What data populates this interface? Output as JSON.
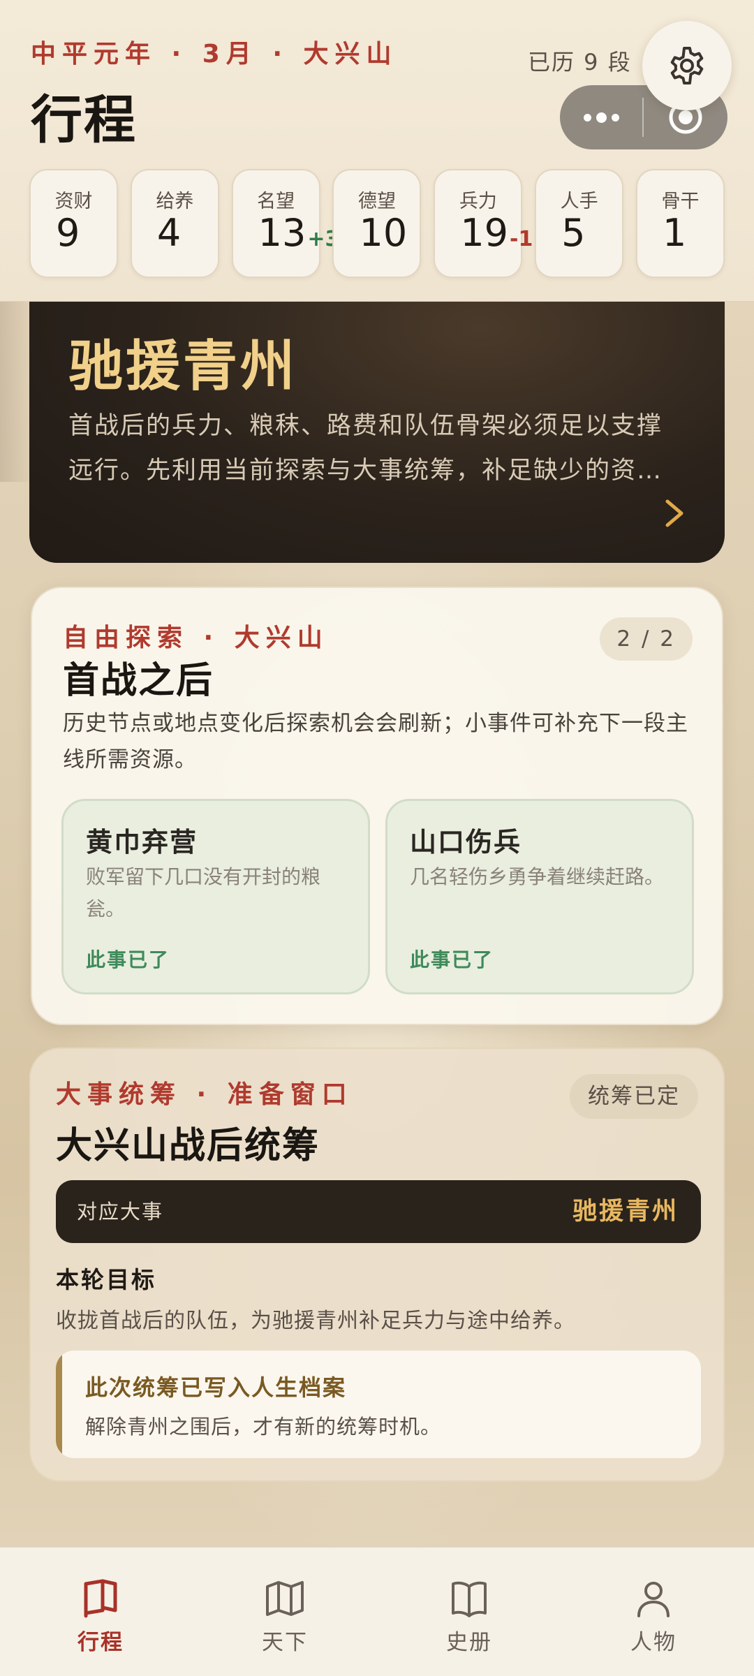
{
  "header": {
    "eyebrow": "中平元年 · 3月 · 大兴山",
    "title": "行程",
    "progress": "已历 9 段"
  },
  "stats": [
    {
      "label": "资财",
      "value": "9",
      "delta": ""
    },
    {
      "label": "给养",
      "value": "4",
      "delta": ""
    },
    {
      "label": "名望",
      "value": "13",
      "delta": "+3"
    },
    {
      "label": "德望",
      "value": "10",
      "delta": ""
    },
    {
      "label": "兵力",
      "value": "19",
      "delta": "-1"
    },
    {
      "label": "人手",
      "value": "5",
      "delta": ""
    },
    {
      "label": "骨干",
      "value": "1",
      "delta": ""
    }
  ],
  "hero": {
    "title": "驰援青州",
    "description": "首战后的兵力、粮秣、路费和队伍骨架必须足以支撑远行。先利用当前探索与大事统筹，补足缺少的资源。"
  },
  "explore": {
    "eyebrow": "自由探索 · 大兴山",
    "title": "首战之后",
    "page": "2 / 2",
    "description": "历史节点或地点变化后探索机会会刷新；小事件可补充下一段主线所需资源。",
    "events": [
      {
        "title": "黄巾弃营",
        "desc": "败军留下几口没有开封的粮瓮。",
        "status": "此事已了"
      },
      {
        "title": "山口伤兵",
        "desc": "几名轻伤乡勇争着继续赶路。",
        "status": "此事已了"
      }
    ]
  },
  "plan": {
    "eyebrow": "大事统筹 · 准备窗口",
    "title": "大兴山战后统筹",
    "badge": "统筹已定",
    "event_label": "对应大事",
    "event_value": "驰援青州",
    "goal_label": "本轮目标",
    "goal_text": "收拢首战后的队伍，为驰援青州补足兵力与途中给养。",
    "note_title": "此次统筹已写入人生档案",
    "note_text": "解除青州之围后，才有新的统筹时机。"
  },
  "tabs": [
    {
      "label": "行程",
      "icon": "flag-icon",
      "active": true
    },
    {
      "label": "天下",
      "icon": "map-icon",
      "active": false
    },
    {
      "label": "史册",
      "icon": "book-icon",
      "active": false
    },
    {
      "label": "人物",
      "icon": "person-icon",
      "active": false
    }
  ],
  "colors": {
    "accent_red": "#b03a2e",
    "gold": "#f1d08a",
    "hero_bg": "#2a221b",
    "success_green": "#3f8a5a",
    "delta_up": "#2f7d4a",
    "delta_down": "#b03a2e"
  }
}
